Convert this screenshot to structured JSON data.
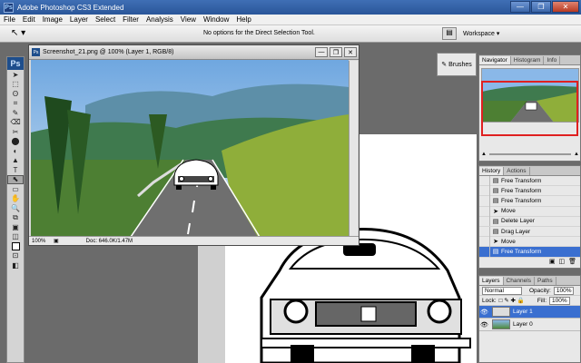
{
  "app": {
    "title": "Adobe Photoshop CS3 Extended",
    "logo": "Ps",
    "window_buttons": [
      "—",
      "❐",
      "✕"
    ]
  },
  "menu": [
    "File",
    "Edit",
    "Image",
    "Layer",
    "Select",
    "Filter",
    "Analysis",
    "View",
    "Window",
    "Help"
  ],
  "options": {
    "tool_icon": "direct-selection-arrow-icon",
    "message": "No options for the Direct Selection Tool.",
    "workspace_label": "Workspace ▾"
  },
  "toolbox": {
    "logo": "Ps",
    "tools": [
      "➤",
      "⬚",
      "ʘ",
      "⌗",
      "✎",
      "⌫",
      "✂",
      "⬤",
      "◐",
      "▲",
      "T",
      "⬉",
      "▭",
      "✋",
      "🔍",
      "⧉",
      "▣",
      "◫",
      "□",
      "⊡",
      "◧",
      "◨",
      "◩",
      "◪",
      "◫"
    ]
  },
  "document": {
    "title": "Screenshot_21.png @ 100% (Layer 1, RGB/8)",
    "zoom": "100%",
    "doc_info": "Doc: 646.0K/1.47M",
    "buttons": [
      "—",
      "❐",
      "✕"
    ]
  },
  "brushes": {
    "label": "Brushes"
  },
  "navigator": {
    "tabs": [
      "Navigator",
      "Histogram",
      "Info"
    ]
  },
  "history": {
    "tabs": [
      "History",
      "Actions"
    ],
    "items": [
      {
        "label": "Free Transform",
        "selected": false
      },
      {
        "label": "Free Transform",
        "selected": false
      },
      {
        "label": "Free Transform",
        "selected": false
      },
      {
        "label": "Move",
        "selected": false
      },
      {
        "label": "Delete Layer",
        "selected": false
      },
      {
        "label": "Drag Layer",
        "selected": false
      },
      {
        "label": "Move",
        "selected": false
      },
      {
        "label": "Free Transform",
        "selected": true
      }
    ]
  },
  "layers": {
    "tabs": [
      "Layers",
      "Channels",
      "Paths"
    ],
    "blend_mode": "Normal",
    "opacity_label": "Opacity:",
    "opacity": "100%",
    "lock_label": "Lock:",
    "fill_label": "Fill:",
    "fill": "100%",
    "items": [
      {
        "name": "Layer 1",
        "selected": true
      },
      {
        "name": "Layer 0",
        "selected": false
      }
    ]
  },
  "colors": {
    "selection": "#3a6fd0",
    "nav_frame": "#e02020"
  }
}
